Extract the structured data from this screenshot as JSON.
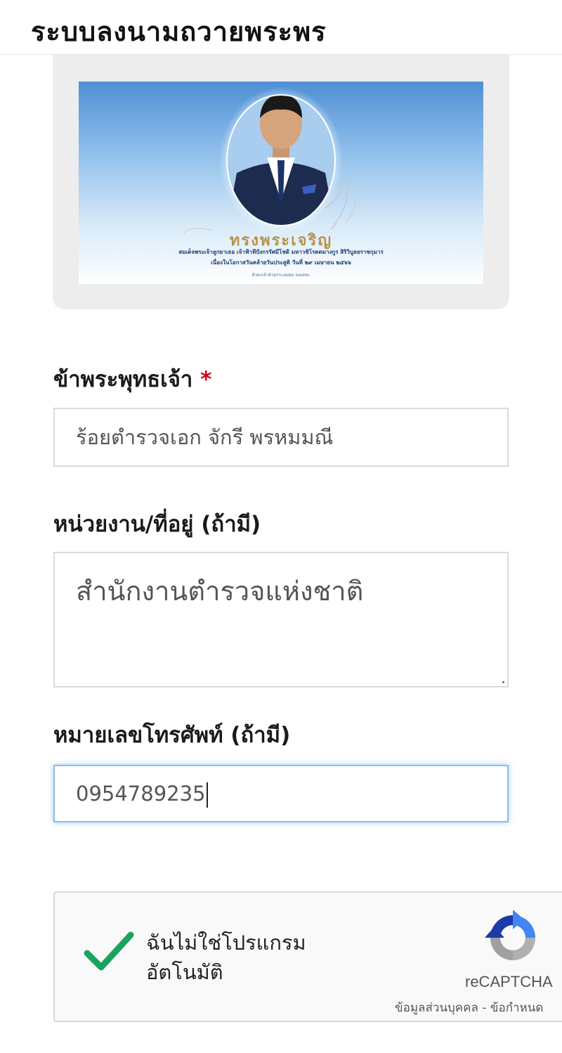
{
  "header": {
    "title": "ระบบลงนามถวายพระพร"
  },
  "banner": {
    "honor_text": "ทรงพระเจริญ",
    "line1": "สมเด็จพระเจ้าลูกยาเธอ เจ้าฟ้าทีปังกรรัศมีโชติ มหาวชิโรตตมางกูร สิริวิบูลยราชกุมาร",
    "line2": "เนื่องในโอกาสวันคล้ายวันประสูติ วันที่ ๒๙ เมษายน ๒๕๖๖",
    "line3": "ด้วยเกล้าด้วยกระหม่อม ขอเดชะ"
  },
  "form": {
    "name_label": "ข้าพระพุทธเจ้า",
    "required_mark": "*",
    "name_value": "ร้อยตำรวจเอก จักรี พรหมมณี",
    "org_label": "หน่วยงาน/ที่อยู่ (ถ้ามี)",
    "org_value": "สำนักงานตำรวจแห่งชาติ",
    "phone_label": "หมายเลขโทรศัพท์ (ถ้ามี)",
    "phone_value": "0954789235"
  },
  "captcha": {
    "label_line1": "ฉันไม่ใช่โปรแกรม",
    "label_line2": "อัตโนมัติ",
    "brand": "reCAPTCHA",
    "privacy": "ข้อมูลส่วนบุคคล - ข้อกำหนด",
    "checked": true
  }
}
